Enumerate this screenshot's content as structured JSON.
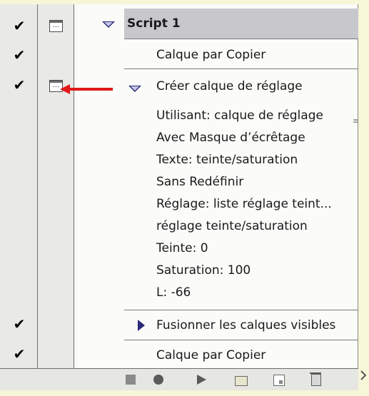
{
  "script_row": {
    "label": "Script 1"
  },
  "actions": [
    {
      "label": "Calque par Copier"
    },
    {
      "label": "Créer calque de réglage",
      "details": [
        "Utilisant: calque de réglage",
        "Avec Masque d’écrêtage",
        "Texte: teinte/saturation",
        "Sans Redéfinir",
        "Réglage: liste réglage teint...",
        "réglage teinte/saturation",
        "Teinte: 0",
        "Saturation: 100",
        "L: -66"
      ]
    },
    {
      "label": "Fusionner les calques visibles"
    },
    {
      "label": "Calque par Copier"
    }
  ],
  "dialog_icon_text": "...",
  "checkmark": "✔",
  "colors": {
    "highlight_arrow": "#e01818",
    "selected_row": "#c8c8cc"
  }
}
